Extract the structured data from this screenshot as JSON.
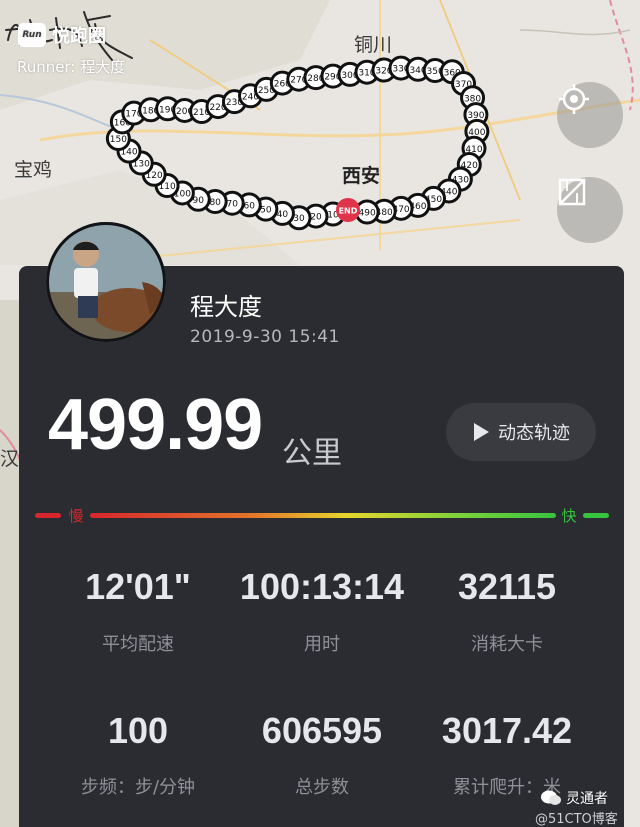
{
  "app": {
    "name": "悦跑圈",
    "logo_text": "Run"
  },
  "runner_line": "Runner: 程大度",
  "map": {
    "cities": [
      "铜川",
      "宝鸡",
      "西安",
      "汉中"
    ],
    "route_markers": [
      "10",
      "20",
      "30",
      "40",
      "50",
      "60",
      "70",
      "80",
      "90",
      "100",
      "110",
      "120",
      "130",
      "140",
      "150",
      "160",
      "170",
      "180",
      "190",
      "200",
      "210",
      "220",
      "230",
      "240",
      "250",
      "260",
      "270",
      "280",
      "290",
      "300",
      "310",
      "320",
      "330",
      "340",
      "350",
      "360",
      "370",
      "380",
      "390",
      "400",
      "410",
      "420",
      "430",
      "440",
      "450",
      "460",
      "470",
      "480",
      "490"
    ],
    "end_label": "END"
  },
  "user": {
    "name": "程大度",
    "date": "2019-9-30 15:41"
  },
  "run": {
    "distance": "499.99",
    "unit": "公里"
  },
  "replay_button": "动态轨迹",
  "pace_bar": {
    "slow_label": "慢",
    "fast_label": "快"
  },
  "stats": [
    {
      "value": "12'01\"",
      "label": "平均配速"
    },
    {
      "value": "100:13:14",
      "label": "用时"
    },
    {
      "value": "32115",
      "label": "消耗大卡"
    },
    {
      "value": "100",
      "label": "步频：步/分钟"
    },
    {
      "value": "606595",
      "label": "总步数"
    },
    {
      "value": "3017.42",
      "label": "累计爬升：米"
    }
  ],
  "watermark": {
    "name": "灵通者",
    "sub": "@51CTO博客"
  },
  "colors": {
    "card": "#2a2c32",
    "route": "#f6e800",
    "end": "#e0344a"
  }
}
